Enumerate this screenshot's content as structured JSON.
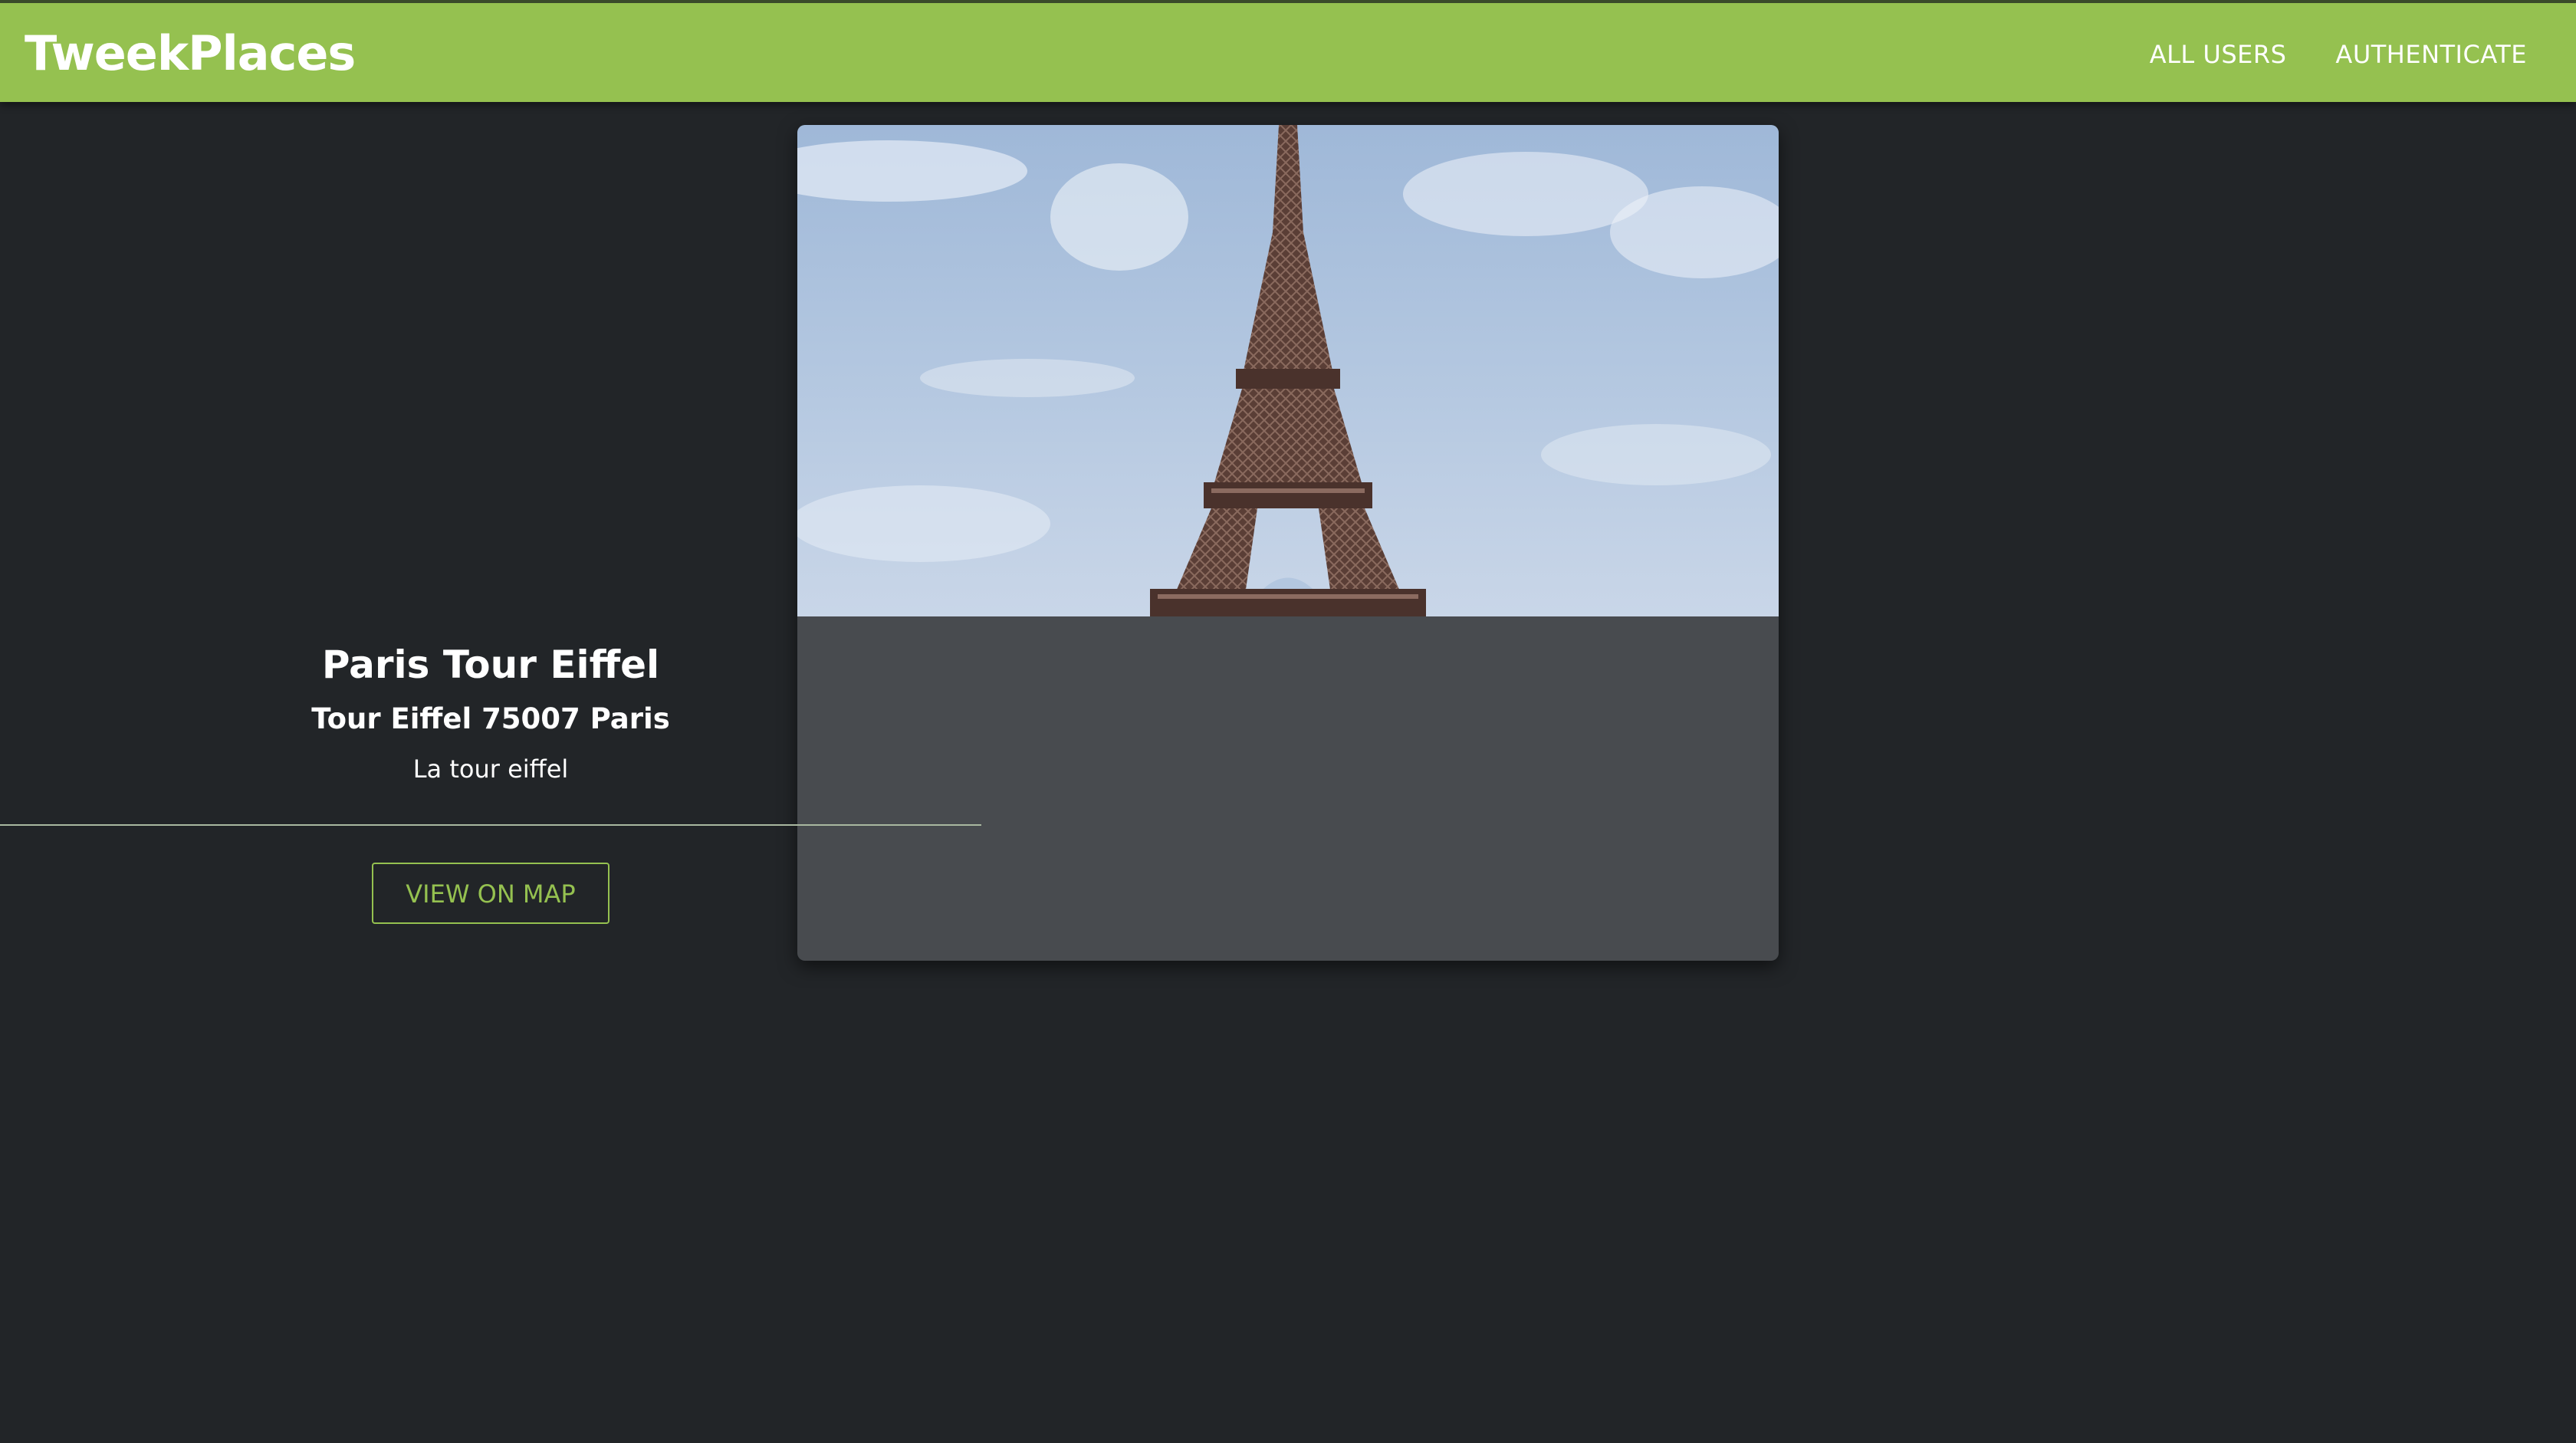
{
  "header": {
    "brand": "TweekPlaces",
    "nav": [
      {
        "label": "ALL USERS"
      },
      {
        "label": "AUTHENTICATE"
      }
    ],
    "background_color": "#95c150"
  },
  "place": {
    "image_alt": "Eiffel Tower against a blue sky",
    "title": "Paris Tour Eiffel",
    "address": "Tour Eiffel 75007 Paris",
    "description": "La tour eiffel",
    "map_button_label": "VIEW ON MAP"
  },
  "colors": {
    "page_background": "#222528",
    "card_background": "#484b4f",
    "accent": "#95c150"
  }
}
